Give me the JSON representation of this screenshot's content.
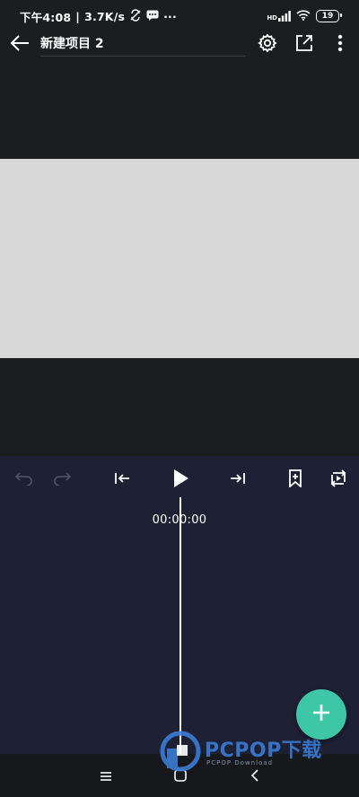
{
  "status_bar": {
    "time": "下午4:08",
    "separator": "|",
    "speed": "3.7K/s",
    "more": "···",
    "signal_label": "HD",
    "battery": "19"
  },
  "app_bar": {
    "project_title": "新建项目 2",
    "icons": [
      "back-arrow-icon",
      "settings-gear-icon",
      "export-share-icon",
      "more-vert-icon"
    ]
  },
  "editor": {
    "timecode": "00:00:00",
    "controls": [
      "undo-icon",
      "redo-icon",
      "skip-to-start-icon",
      "play-icon",
      "skip-to-end-icon",
      "bookmark-add-icon",
      "loop-play-icon"
    ]
  },
  "fab": {
    "icon": "plus-icon"
  },
  "navigation": {
    "icons": [
      "menu-lines-icon",
      "home-square-icon",
      "back-chevron-icon"
    ]
  },
  "watermark": {
    "brand": "PCPOP下载",
    "subtitle": "PCPOP Download"
  },
  "colors": {
    "background": "#1a1e20",
    "canvas": "#d8d8d8",
    "timeline": "#1e2034",
    "accent": "#3ec7a6",
    "watermark_blue": "#3a7bd5"
  }
}
